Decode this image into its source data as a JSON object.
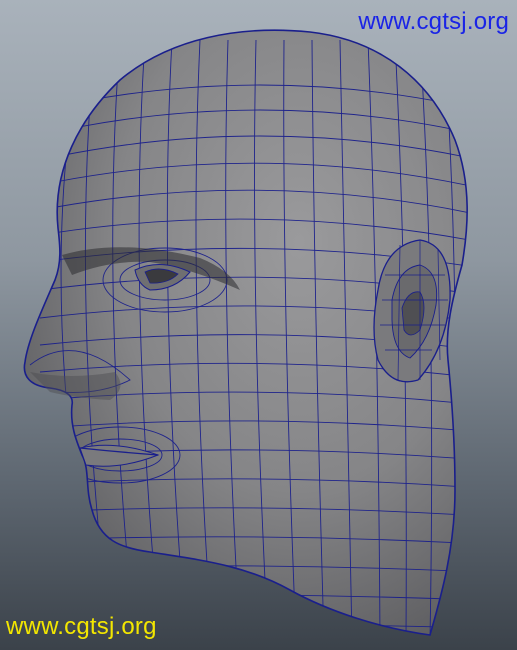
{
  "colors": {
    "background_top": "#a9b2bb",
    "background_bottom": "#3b424a",
    "mesh_fill_light": "#8f8f91",
    "mesh_fill_dark": "#5f5f62",
    "wireframe": "#1a1f8c",
    "watermark_top": "#1a24e6",
    "watermark_bottom": "#f3e600"
  },
  "watermarks": {
    "top_text": "www.cgtsj.org",
    "bottom_text": "www.cgtsj.org"
  },
  "image": {
    "subject_icon": "3d-head-wireframe-mesh"
  }
}
